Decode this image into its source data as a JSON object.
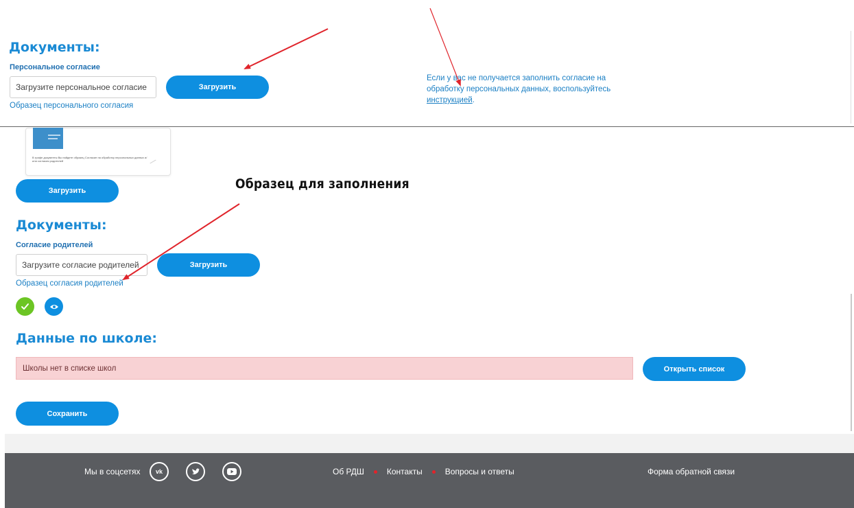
{
  "top_section": {
    "heading": "Документы:",
    "sublabel": "Персональное согласие",
    "input_placeholder": "Загрузите персональное согласие",
    "upload_button": "Загрузить",
    "sample_link": "Образец персонального согласия",
    "help_text_1": "Если у вас не получается заполнить согласие на",
    "help_text_2": "обработку персональных данных, воспользуйтесь",
    "help_link": "инструкцией",
    "help_end": "."
  },
  "thumbnail": {
    "caption": "В графе документы Вы найдете образец Согласие на обработку персональных данных и/или согласия родителей"
  },
  "middle": {
    "upload_button": "Загрузить",
    "banner": "Образец для заполнения"
  },
  "parents_section": {
    "heading": "Документы:",
    "sublabel": "Согласие родителей",
    "input_placeholder": "Загрузите согласие родителей",
    "upload_button": "Загрузить",
    "sample_link": "Образец согласия родителей"
  },
  "school_section": {
    "heading": "Данные по школе:",
    "alert_text": "Школы нет в списке школ",
    "open_list_button": "Открыть список"
  },
  "save_button": "Сохранить",
  "footer": {
    "social_label": "Мы в соцсетях",
    "nav": [
      "Об РДШ",
      "Контакты",
      "Вопросы и ответы"
    ],
    "feedback": "Форма обратной связи",
    "social_icons": [
      "vk-icon",
      "twitter-icon",
      "youtube-icon"
    ]
  },
  "colors": {
    "accent": "#0e8fe0",
    "heading": "#1a8ad4",
    "success": "#6cc524",
    "alert_bg": "#f8d2d4",
    "footer_bg": "#5a5c60",
    "arrow": "#e0242b"
  }
}
